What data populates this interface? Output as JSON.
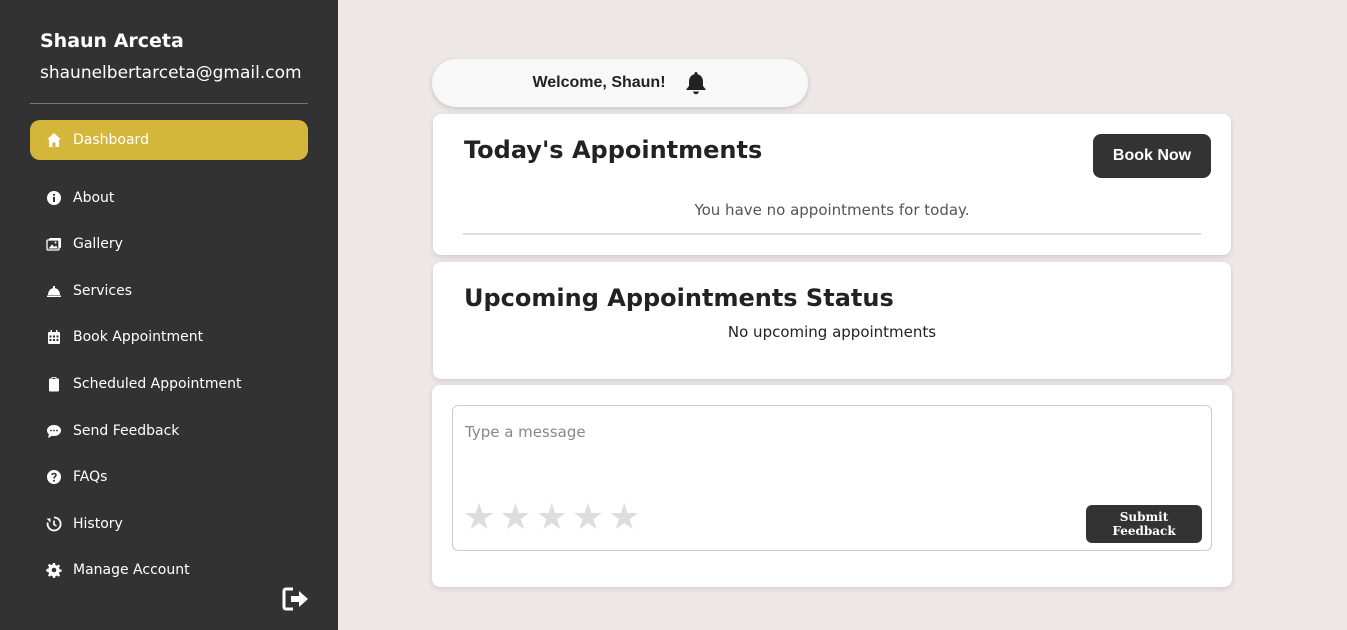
{
  "user": {
    "name": "Shaun Arceta",
    "email": "shaunelbertarceta@gmail.com"
  },
  "sidebar": {
    "items": [
      {
        "label": "Dashboard",
        "icon": "home-icon",
        "active": true
      },
      {
        "label": "About",
        "icon": "info-icon"
      },
      {
        "label": "Gallery",
        "icon": "images-icon"
      },
      {
        "label": "Services",
        "icon": "service-bell-icon"
      },
      {
        "label": "Book Appointment",
        "icon": "calendar-icon"
      },
      {
        "label": "Scheduled Appointment",
        "icon": "clipboard-icon"
      },
      {
        "label": "Send Feedback",
        "icon": "comment-icon"
      },
      {
        "label": "FAQs",
        "icon": "question-icon"
      },
      {
        "label": "History",
        "icon": "history-icon"
      },
      {
        "label": "Manage Account",
        "icon": "gear-icon"
      }
    ],
    "logout_icon": "logout-icon",
    "active_color": "#d4b73a",
    "background": "#323232"
  },
  "header": {
    "welcome": "Welcome, Shaun!",
    "bell_icon": "bell-icon"
  },
  "today": {
    "title": "Today's Appointments",
    "book_label": "Book Now",
    "empty_text": "You have no appointments for today."
  },
  "upcoming": {
    "title": "Upcoming Appointments Status",
    "empty_text": "No upcoming appointments"
  },
  "feedback": {
    "placeholder": "Type a message",
    "value": "",
    "rating": 0,
    "max_rating": 5,
    "submit_label": "Submit Feedback"
  }
}
